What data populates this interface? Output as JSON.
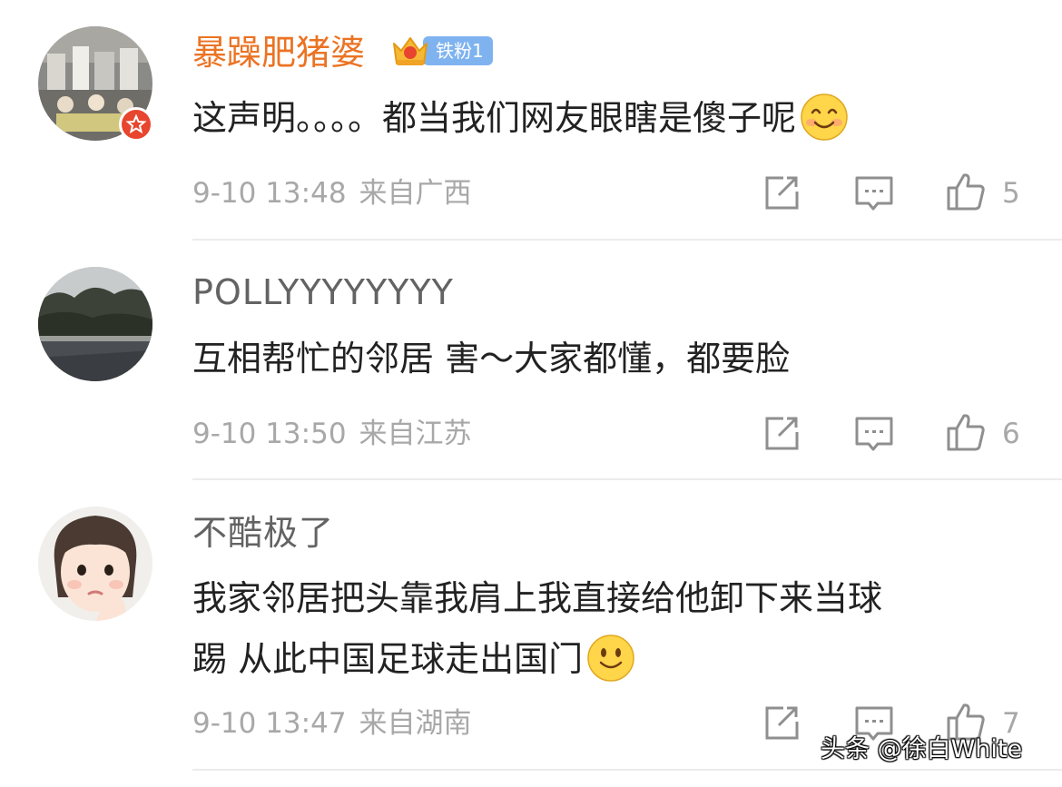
{
  "comments": [
    {
      "username": "暴躁肥猪婆",
      "fan_badge": {
        "level_label": "铁粉1"
      },
      "text": "这声明。。。。都当我们网友眼瞎是傻子呢",
      "emoji": "smile-emoji",
      "time": "9-10 13:48",
      "location": "来自广西",
      "likes": "5"
    },
    {
      "username": "POLLYYYYYYYY",
      "text": "互相帮忙的邻居 害～大家都懂，都要脸",
      "time": "9-10 13:50",
      "location": "来自江苏",
      "likes": "6"
    },
    {
      "username": "不酷极了",
      "text_line1": "我家邻居把头靠我肩上我直接给他卸下来当球",
      "text_line2": "踢 从此中国足球走出国门",
      "emoji": "smile-emoji",
      "time": "9-10 13:47",
      "location": "来自湖南",
      "likes": "7"
    }
  ],
  "watermark": "头条 @徐白White",
  "icons": {
    "share": "share-icon",
    "comment": "comment-icon",
    "like": "thumbs-up-icon"
  },
  "colors": {
    "username_highlight": "#eb7323",
    "fan_badge": "#7fb3f0",
    "meta_text": "#a8a8a8"
  }
}
